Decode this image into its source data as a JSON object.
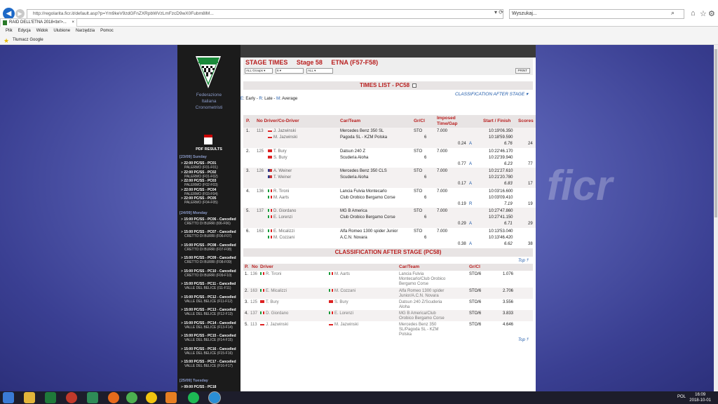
{
  "browser": {
    "url": "http://regolarita.ficr.it/default.asp?p=Ym9keV9zdGFnZXRpbWVzLmFzcD9wX0Fubm8lM...",
    "search_placeholder": "Wyszukaj...",
    "tab_title": "RAID DELL'ETNA 2018<br/>...",
    "menu": [
      "Plik",
      "Edycja",
      "Widok",
      "Ulubione",
      "Narzędzia",
      "Pomoc"
    ],
    "favorite": "Tłumacz Google"
  },
  "sidebar": {
    "federation": [
      "Federazione",
      "Italiana",
      "Cronometristi"
    ],
    "pdf_label": "PDF RESULTS",
    "days": [
      {
        "label": "[23/09] Sunday",
        "items": [
          {
            "text": "22:00 PC/SS - PC01",
            "sub": "PALERMO (F01-F01)"
          },
          {
            "text": "22:00 PC/SS - PC02",
            "sub": "PALERMO (F01-F02)"
          },
          {
            "text": "22:00 PC/SS - PC03",
            "sub": "PALERMO (F02-F03)"
          },
          {
            "text": "22:00 PC/SS - PC04",
            "sub": "PALERMO (F03-F04)"
          },
          {
            "text": "22:00 PC/SS - PC05",
            "sub": "PALERMO (F04-F05)"
          }
        ]
      },
      {
        "label": "[24/09] Monday",
        "items": [
          {
            "text": "15:00 PC/SS - PC06 - Cancelled",
            "sub": "CRETTO DI BURRI (I06-F06)"
          },
          {
            "text": "15:00 PC/SS - PC07 - Cancelled",
            "sub": "CRETTO DI BURRI (F06-F07)"
          },
          {
            "text": "15:00 PC/SS - PC08 - Cancelled",
            "sub": "CRETTO DI BURRI (F07-F08)"
          },
          {
            "text": "15:00 PC/SS - PC09 - Cancelled",
            "sub": "CRETTO DI BURRI (F08-F09)"
          },
          {
            "text": "15:00 PC/SS - PC10 - Cancelled",
            "sub": "CRETTO DI BURRI (F09-F10)"
          },
          {
            "text": "15:00 PC/SS - PC11 - Cancelled",
            "sub": "VALLE DEL BELICE (I11-F11)"
          },
          {
            "text": "15:00 PC/SS - PC12 - Cancelled",
            "sub": "VALLE DEL BELICE (F11-F12)"
          },
          {
            "text": "15:00 PC/SS - PC13 - Cancelled",
            "sub": "VALLE DEL BELICE (F12-F13)"
          },
          {
            "text": "15:00 PC/SS - PC14 - Cancelled",
            "sub": "VALLE DEL BELICE (F13-F14)"
          },
          {
            "text": "15:00 PC/SS - PC15 - Cancelled",
            "sub": "VALLE DEL BELICE (F14-F15)"
          },
          {
            "text": "15:00 PC/SS - PC16 - Cancelled",
            "sub": "VALLE DEL BELICE (F15-F16)"
          },
          {
            "text": "15:00 PC/SS - PC17 - Cancelled",
            "sub": "VALLE DEL BELICE (F16-F17)"
          }
        ]
      },
      {
        "label": "[25/09] Tuesday",
        "items": [
          {
            "text": "09:00 PC/SS - PC18",
            "sub": ""
          }
        ]
      }
    ]
  },
  "main": {
    "stage_title": "STAGE TIMES",
    "stage_num": "Stage 58",
    "stage_name": "ETNA (F57-F58)",
    "filters": [
      "ALL Groups",
      "6",
      "ALL"
    ],
    "print_label": "PRINT",
    "times_header": "TIMES LIST - PC58",
    "class_link": "CLASSIFICATION AFTER STAGE",
    "legend": {
      "e_key": "E",
      "e": "Early",
      "r_key": "R",
      "r": "Late",
      "m_key": "M",
      "m": "Average"
    },
    "times_columns": [
      "P.",
      "No Driver/Co-Driver",
      "Car/Team",
      "Gr/Cl",
      "Imposed Time/Gap",
      "Start / Finish",
      "Scores"
    ],
    "times_rows": [
      {
        "pos": "1.",
        "no": "113",
        "driver": "J. Jazwinski",
        "codriver": "M. Jazwinski",
        "f1": "pl",
        "f2": "pl",
        "car": "Mercedes Benz 350 SL",
        "team": "Pagoda SL - KZM Polska",
        "gr": "STO",
        "cl": "6",
        "imposed": "7.000",
        "gap": "0.24",
        "gap_key": "A",
        "start": "10:19'06.350",
        "finish": "10:18'59.590",
        "avg": "6.76",
        "score": "24"
      },
      {
        "pos": "2.",
        "no": "125",
        "driver": "T. Bury",
        "codriver": "S. Bury",
        "f1": "ch",
        "f2": "ch",
        "car": "Datsun 240 Z",
        "team": "Scuderia Aloha",
        "gr": "STO",
        "cl": "6",
        "imposed": "7.000",
        "gap": "0.77",
        "gap_key": "A",
        "start": "10:22'46.170",
        "finish": "10:22'39.940",
        "avg": "6.23",
        "score": "77"
      },
      {
        "pos": "3.",
        "no": "126",
        "driver": "A. Weiner",
        "codriver": "T. Weiner",
        "f1": "us",
        "f2": "us",
        "car": "Mercedes Benz 350 CLS",
        "team": "Scuderia Aloha",
        "gr": "STO",
        "cl": "6",
        "imposed": "7.000",
        "gap": "0.17",
        "gap_key": "A",
        "start": "10:21'27.610",
        "finish": "10:21'20.780",
        "avg": "6.83",
        "score": "17"
      },
      {
        "pos": "4.",
        "no": "136",
        "driver": "R. Tironi",
        "codriver": "M. Aarts",
        "f1": "it",
        "f2": "it",
        "car": "Lancia Fulvia Montecarlo",
        "team": "Club Orobico Bergamo Corse",
        "gr": "STO",
        "cl": "6",
        "imposed": "7.000",
        "gap": "0.19",
        "gap_key": "R",
        "start": "10:03'16.600",
        "finish": "10:03'09.410",
        "avg": "7.19",
        "score": "19"
      },
      {
        "pos": "5.",
        "no": "137",
        "driver": "D. Giordano",
        "codriver": "E. Lorenzi",
        "f1": "it",
        "f2": "it",
        "car": "MG B America",
        "team": "Club Orobico Bergamo Corse",
        "gr": "STO",
        "cl": "6",
        "imposed": "7.000",
        "gap": "0.29",
        "gap_key": "A",
        "start": "10:27'47.860",
        "finish": "10:27'41.150",
        "avg": "6.71",
        "score": "29"
      },
      {
        "pos": "6.",
        "no": "163",
        "driver": "E. Micalizzi",
        "codriver": "M. Cozzani",
        "f1": "it",
        "f2": "it",
        "car": "Alfa Romeo 1300 spider Junior",
        "team": "A.C.N. Novara",
        "gr": "STO",
        "cl": "6",
        "imposed": "7.000",
        "gap": "0.38",
        "gap_key": "A",
        "start": "10:13'53.040",
        "finish": "10:13'46.420",
        "avg": "6.62",
        "score": "38"
      }
    ],
    "class_header": "CLASSIFICATION AFTER STAGE (PC58)",
    "top_label": "Top",
    "class_columns": [
      "P.",
      "No",
      "Driver",
      "Car/Team",
      "Gr/Cl"
    ],
    "class_rows": [
      {
        "pos": "1.",
        "no": "136",
        "driver": "R. Tironi",
        "codriver": "M. Aarts",
        "f": "it",
        "car": [
          "Lancia Fulvia",
          "Montecarlo/Club Orobico",
          "Bergamo Corse"
        ],
        "grcl": "STO/6",
        "score": "1.076"
      },
      {
        "pos": "2.",
        "no": "163",
        "driver": "E. Micalizzi",
        "codriver": "M. Cozzani",
        "f": "it",
        "car": [
          "Alfa Romeo 1300 spider",
          "Junior/A.C.N. Novara"
        ],
        "grcl": "STO/6",
        "score": "2.706"
      },
      {
        "pos": "3.",
        "no": "125",
        "driver": "T. Bury",
        "codriver": "S. Bury",
        "f": "ch",
        "car": [
          "Datsun 240 Z/Scuderia",
          "Aloha"
        ],
        "grcl": "STO/6",
        "score": "3.556"
      },
      {
        "pos": "4.",
        "no": "137",
        "driver": "D. Giordano",
        "codriver": "E. Lorenzi",
        "f": "it",
        "car": [
          "MG B America/Club",
          "Orobico Bergamo Corse"
        ],
        "grcl": "STO/6",
        "score": "3.833"
      },
      {
        "pos": "5.",
        "no": "113",
        "driver": "J. Jazwinski",
        "codriver": "M. Jazwinski",
        "f": "pl",
        "car": [
          "Mercedes Benz 350",
          "SL/Pagoda SL - KZM",
          "Polska"
        ],
        "grcl": "STO/6",
        "score": "4.646"
      }
    ]
  },
  "taskbar": {
    "lang": "POL",
    "time": "16:09",
    "date": "2018-10-01"
  },
  "colors": {
    "accent": "#b81e1e",
    "link": "#1b57a8",
    "sidebar": "#1b1b1b"
  }
}
